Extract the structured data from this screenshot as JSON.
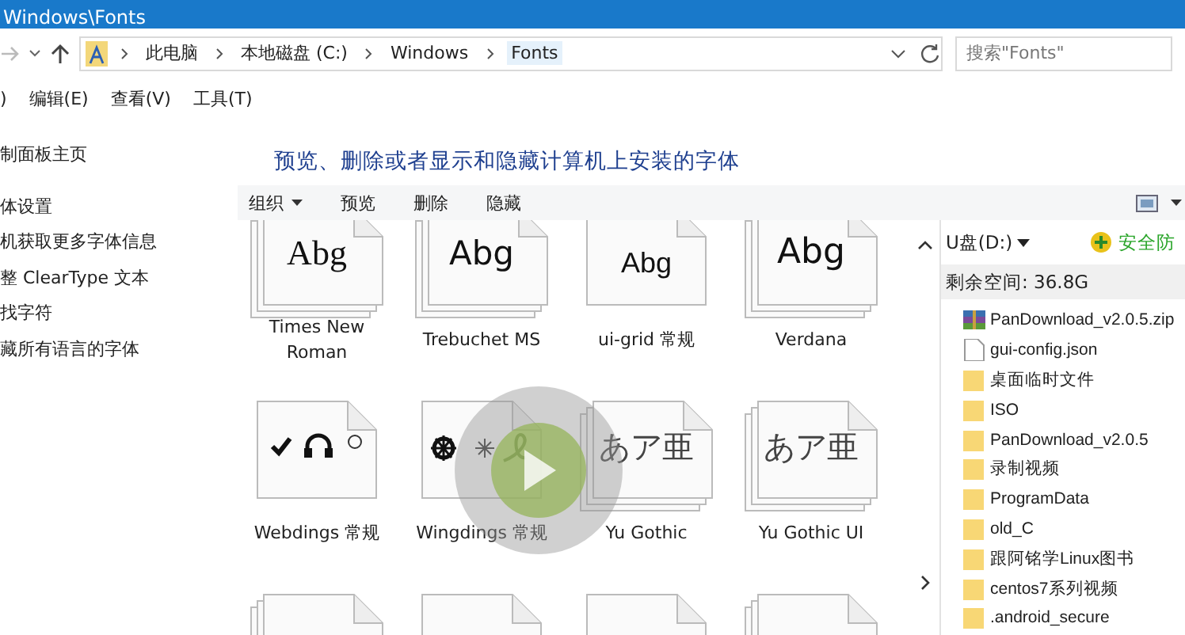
{
  "window": {
    "title": "Windows\\Fonts"
  },
  "address_bar": {
    "crumbs": [
      "此电脑",
      "本地磁盘 (C:)",
      "Windows",
      "Fonts"
    ],
    "search": {
      "placeholder": "搜索\"Fonts\""
    }
  },
  "menu_bar": [
    ")",
    "编辑(E)",
    "查看(V)",
    "工具(T)"
  ],
  "sidebar": {
    "items": [
      "制面板主页",
      "体设置",
      "机获取更多字体信息",
      "整 ClearType 文本",
      "找字符",
      "藏所有语言的字体"
    ]
  },
  "heading": "预览、删除或者显示和隐藏计算机上安装的字体",
  "toolbar": [
    {
      "label": "组织",
      "kind": "menu"
    },
    {
      "label": "预览",
      "kind": "plain"
    },
    {
      "label": "删除",
      "kind": "plain"
    },
    {
      "label": "隐藏",
      "kind": "plain"
    }
  ],
  "fonts": [
    {
      "name": "Times New Roman",
      "kind": "family",
      "sample": "Abg"
    },
    {
      "name": "Trebuchet MS",
      "kind": "family",
      "sample": "Abg"
    },
    {
      "name": "ui-grid 常规",
      "kind": "single",
      "sample": "Abg"
    },
    {
      "name": "Verdana",
      "kind": "family",
      "sample": "Abg"
    },
    {
      "name": "Webdings 常规",
      "kind": "single"
    },
    {
      "name": "Wingdings 常规",
      "kind": "single"
    },
    {
      "name": "Yu Gothic",
      "kind": "family",
      "sample": "あア亜"
    },
    {
      "name": "Yu Gothic UI",
      "kind": "family",
      "sample": "あア亜"
    },
    {
      "kind": "family"
    },
    {
      "kind": "single"
    },
    {
      "kind": "single"
    },
    {
      "kind": "family"
    }
  ],
  "drive_panel": {
    "drive": "U盘(D:)",
    "security": "安全防",
    "free_space": "剩余空间: 36.8G",
    "items": [
      {
        "name": "PanDownload_v2.0.5.zip",
        "kind": "archive"
      },
      {
        "name": "gui-config.json",
        "kind": "file"
      },
      {
        "name": "桌面临时文件",
        "kind": "folder"
      },
      {
        "name": "ISO",
        "kind": "folder"
      },
      {
        "name": "PanDownload_v2.0.5",
        "kind": "folder"
      },
      {
        "name": "录制视频",
        "kind": "folder"
      },
      {
        "name": "ProgramData",
        "kind": "folder"
      },
      {
        "name": "old_C",
        "kind": "folder"
      },
      {
        "name": "跟阿铭学Linux图书",
        "kind": "folder"
      },
      {
        "name": "centos7系列视频",
        "kind": "folder"
      },
      {
        "name": ".android_secure",
        "kind": "folder"
      }
    ]
  }
}
